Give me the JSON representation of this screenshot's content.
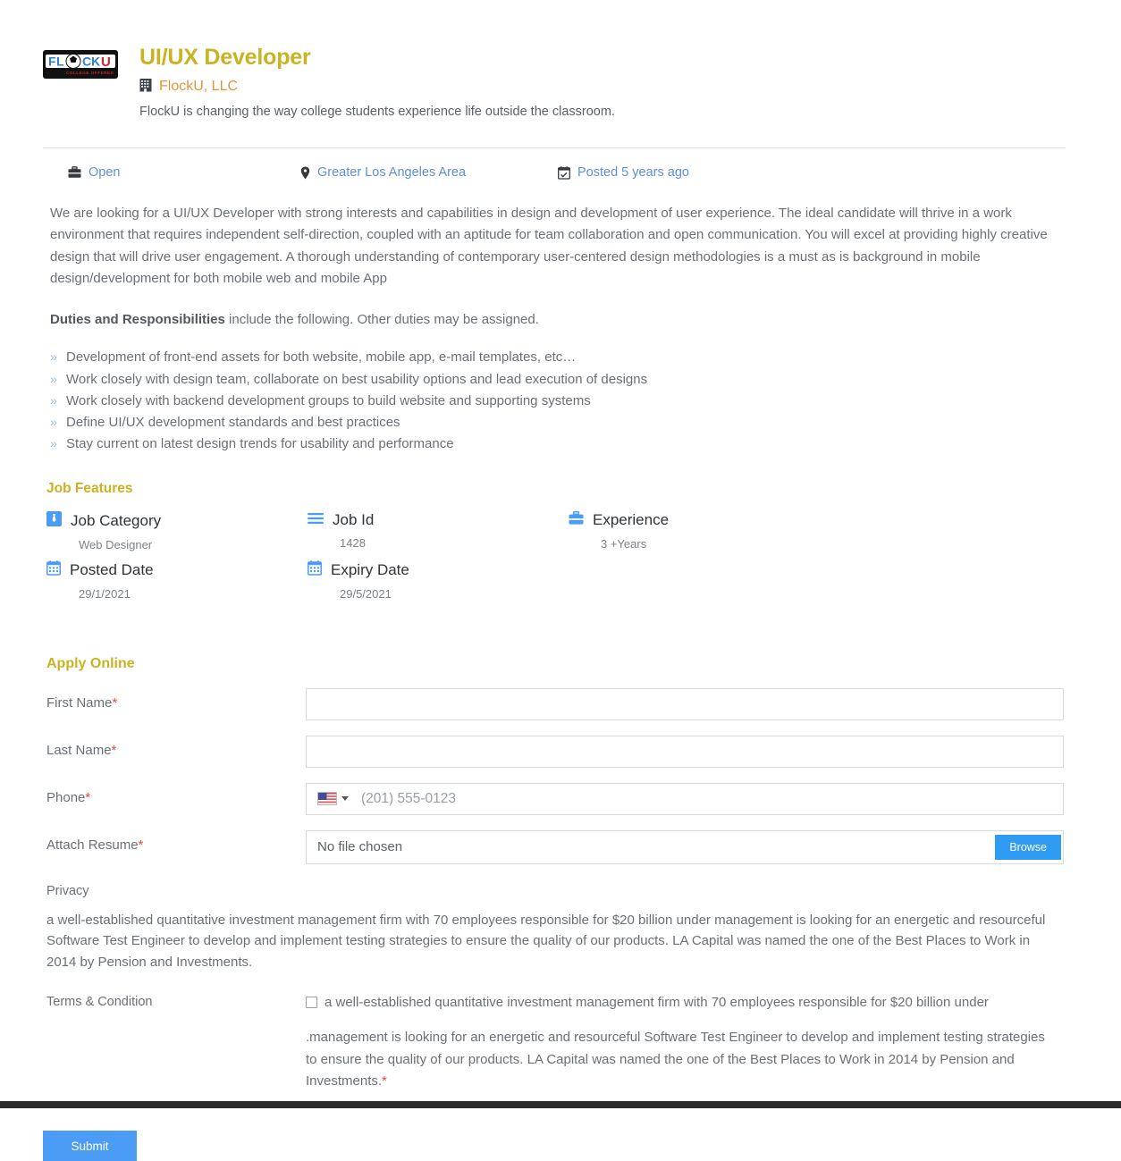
{
  "header": {
    "logo_alt": "FlockU logo",
    "logo_text_primary": "FLOCKU",
    "logo_text_secondary": "COLLEGE OFFERED",
    "job_title": "UI/UX Developer",
    "company_name": "FlockU, LLC",
    "company_tagline": "FlockU is changing the way college students experience life outside the classroom."
  },
  "meta": {
    "status": "Open",
    "location": "Greater Los Angeles Area",
    "posted": "Posted 5 years ago"
  },
  "description": {
    "intro": "We are looking for a UI/UX Developer with strong interests and capabilities in design and development of user experience.  The ideal candidate will thrive in a work environment that requires independent self-direction, coupled with an aptitude for team collaboration and open communication.  You will excel at providing highly creative design that will drive user engagement.  A thorough understanding of contemporary user-centered design methodologies is a must as is background in mobile design/development for both mobile web and mobile App",
    "duties_head_bold": "Duties and Responsibilities",
    "duties_head_rest": " include the following. Other duties may be assigned.",
    "bullet_marker": "»",
    "duties": [
      "Development of front-end assets for both website, mobile app, e-mail templates, etc…",
      "Work closely with design team, collaborate on best usability options and lead execution of designs",
      "Work closely with backend development groups to build website and supporting systems",
      "Define UI/UX development standards and best practices",
      "Stay current on latest design trends for usability and performance"
    ]
  },
  "job_features": {
    "heading": "Job Features",
    "items": [
      {
        "icon": "tie-icon",
        "label": "Job Category",
        "value": "Web Designer"
      },
      {
        "icon": "list-icon",
        "label": "Job Id",
        "value": "1428"
      },
      {
        "icon": "briefcase-icon",
        "label": "Experience",
        "value": "3 +Years"
      },
      {
        "icon": "calendar-icon",
        "label": "Posted Date",
        "value": "29/1/2021"
      },
      {
        "icon": "calendar-icon",
        "label": "Expiry Date",
        "value": "29/5/2021"
      }
    ]
  },
  "apply": {
    "heading": "Apply Online",
    "fields": {
      "first_name_label": "First Name",
      "first_name_value": "",
      "last_name_label": "Last Name",
      "last_name_value": "",
      "phone_label": "Phone",
      "phone_value": "",
      "phone_placeholder": "(201) 555-0123",
      "phone_country": "United States",
      "resume_label": "Attach Resume",
      "resume_value": "No file chosen",
      "browse_label": "Browse",
      "required_marker": "*"
    },
    "privacy_label": "Privacy",
    "privacy_text": "a well-established quantitative investment management firm with 70 employees responsible for $20 billion under management is looking for an energetic and resourceful Software Test Engineer to develop and implement testing strategies to ensure the quality of our products. LA Capital was named the one of the Best Places to Work in 2014 by Pension and Investments.",
    "terms_label": "Terms & Condition",
    "terms_checkbox_text": "a well-established quantitative investment management firm with 70 employees responsible for $20 billion under",
    "terms_paragraph": ".management is looking for an energetic and resourceful Software Test Engineer to develop and implement testing strategies to ensure the quality of our products. LA Capital was named the one of the Best Places to Work in 2014 by Pension and Investments.",
    "terms_required_marker": "*",
    "submit_label": "Submit"
  },
  "colors": {
    "accent_gold": "#c9b320",
    "company_orange": "#e59338",
    "link_blue": "#5f8ee0",
    "icon_blue": "#4a9cf5",
    "button_blue": "#2f9bf3",
    "submit_blue": "#4a9cf5",
    "required_red": "#e8483b",
    "body_text": "#6a7076"
  }
}
